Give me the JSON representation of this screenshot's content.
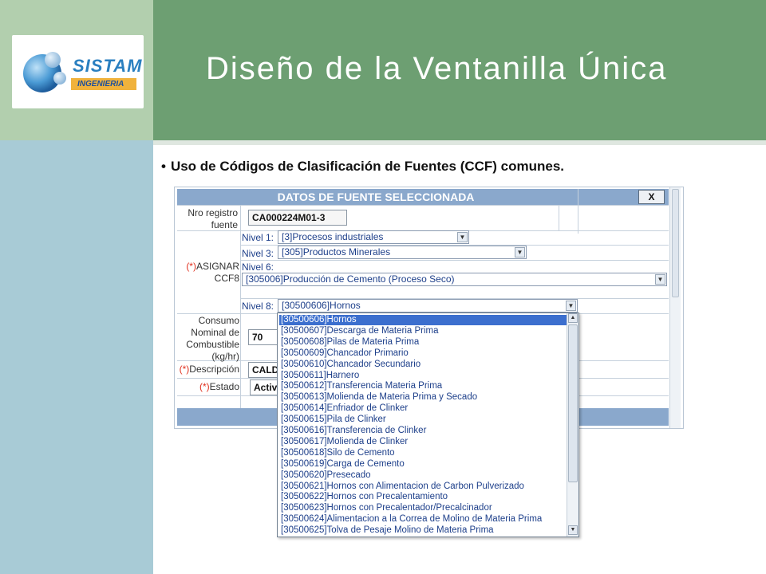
{
  "slide": {
    "title": "Diseño de la Ventanilla Única",
    "bullet": "Uso de Códigos de Clasificación de Fuentes (CCF) comunes."
  },
  "logo": {
    "word": "SISTAM",
    "sub": "INGENIERIA"
  },
  "form": {
    "header": "DATOS DE FUENTE SELECCIONADA",
    "close_label": "X",
    "nro_label": "Nro registro fuente",
    "nro_value": "CA000224M01-3",
    "asignar_req": "(*)",
    "asignar_label": "ASIGNAR CCF8",
    "nivel1_label": "Nivel 1:",
    "nivel1_value": "[3]Procesos industriales",
    "nivel3_label": "Nivel 3:",
    "nivel3_value": "[305]Productos Minerales",
    "nivel6_label": "Nivel 6:",
    "nivel6_value": "[305006]Producción de Cemento (Proceso Seco)",
    "nivel8_label": "Nivel 8:",
    "nivel8_value": "[30500606]Hornos",
    "consumo_label": "Consumo Nominal de Combustible (kg/hr)",
    "consumo_value": "70",
    "descripcion_req": "(*)",
    "descripcion_label": "Descripción",
    "descripcion_value": "CALD",
    "estado_req": "(*)",
    "estado_label": "Estado",
    "estado_value": "Activ"
  },
  "dropdown": {
    "items": [
      "[30500606]Hornos",
      "[30500607]Descarga de Materia Prima",
      "[30500608]Pilas de Materia Prima",
      "[30500609]Chancador Primario",
      "[30500610]Chancador Secundario",
      "[30500611]Harnero",
      "[30500612]Transferencia Materia Prima",
      "[30500613]Molienda de Materia Prima y Secado",
      "[30500614]Enfriador de Clinker",
      "[30500615]Pila de Clinker",
      "[30500616]Transferencia de Clinker",
      "[30500617]Molienda de Clinker",
      "[30500618]Silo de Cemento",
      "[30500619]Carga de Cemento",
      "[30500620]Presecado",
      "[30500621]Hornos con Alimentacion de Carbon Pulverizado",
      "[30500622]Hornos con Precalentamiento",
      "[30500623]Hornos con Precalentador/Precalcinador",
      "[30500624]Alimentacion a la Correa de Molino de Materia Prima",
      "[30500625]Tolva de Pesaje Molino de Materia Prima"
    ],
    "selected_index": 0
  }
}
